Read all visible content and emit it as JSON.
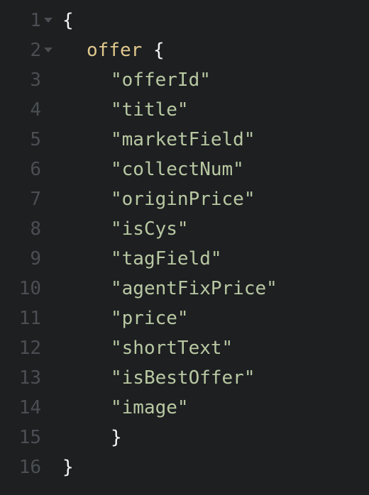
{
  "editor": {
    "lines": [
      {
        "num": "1",
        "indent": 0,
        "text": "{",
        "kind": "punct",
        "foldable": true
      },
      {
        "num": "2",
        "indent": 1,
        "key": "offer",
        "text": "{",
        "kind": "object",
        "foldable": true
      },
      {
        "num": "3",
        "indent": 2,
        "text": "\"offerId\"",
        "kind": "str"
      },
      {
        "num": "4",
        "indent": 2,
        "text": "\"title\"",
        "kind": "str"
      },
      {
        "num": "5",
        "indent": 2,
        "text": "\"marketField\"",
        "kind": "str"
      },
      {
        "num": "6",
        "indent": 2,
        "text": "\"collectNum\"",
        "kind": "str"
      },
      {
        "num": "7",
        "indent": 2,
        "text": "\"originPrice\"",
        "kind": "str"
      },
      {
        "num": "8",
        "indent": 2,
        "text": "\"isCys\"",
        "kind": "str"
      },
      {
        "num": "9",
        "indent": 2,
        "text": "\"tagField\"",
        "kind": "str"
      },
      {
        "num": "10",
        "indent": 2,
        "text": "\"agentFixPrice\"",
        "kind": "str"
      },
      {
        "num": "11",
        "indent": 2,
        "text": "\"price\"",
        "kind": "str"
      },
      {
        "num": "12",
        "indent": 2,
        "text": "\"shortText\"",
        "kind": "str"
      },
      {
        "num": "13",
        "indent": 2,
        "text": "\"isBestOffer\"",
        "kind": "str"
      },
      {
        "num": "14",
        "indent": 2,
        "text": "\"image\"",
        "kind": "str"
      },
      {
        "num": "15",
        "indent": 2,
        "text": "}",
        "kind": "punct"
      },
      {
        "num": "16",
        "indent": 0,
        "text": "}",
        "kind": "punct"
      }
    ],
    "icons": {
      "fold": "chevron-down-icon"
    },
    "colors": {
      "background": "#1d1f21",
      "line_number": "#4b4e52",
      "punctuation": "#f5f5f5",
      "key": "#e0c98c",
      "string": "#b8c8a2"
    }
  }
}
